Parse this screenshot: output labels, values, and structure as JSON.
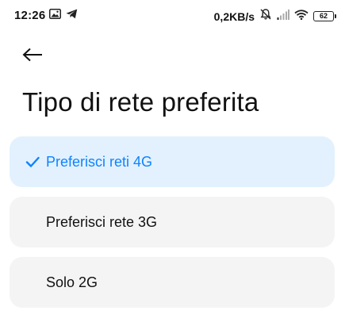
{
  "status_bar": {
    "time": "12:26",
    "net_speed": "0,2KB/s",
    "battery_level": "62",
    "icons": [
      "gallery-notification-icon",
      "telegram-icon",
      "mute-icon",
      "signal-icon",
      "wifi-icon",
      "battery-icon"
    ]
  },
  "header": {
    "back_icon": "arrow-left-icon"
  },
  "page": {
    "title": "Tipo di rete preferita"
  },
  "options": [
    {
      "label": "Preferisci reti 4G",
      "selected": true
    },
    {
      "label": "Preferisci rete 3G",
      "selected": false
    },
    {
      "label": "Solo 2G",
      "selected": false
    }
  ],
  "colors": {
    "accent": "#0d84ff",
    "selected_bg": "#e3f1fe",
    "option_bg": "#f4f4f4"
  }
}
